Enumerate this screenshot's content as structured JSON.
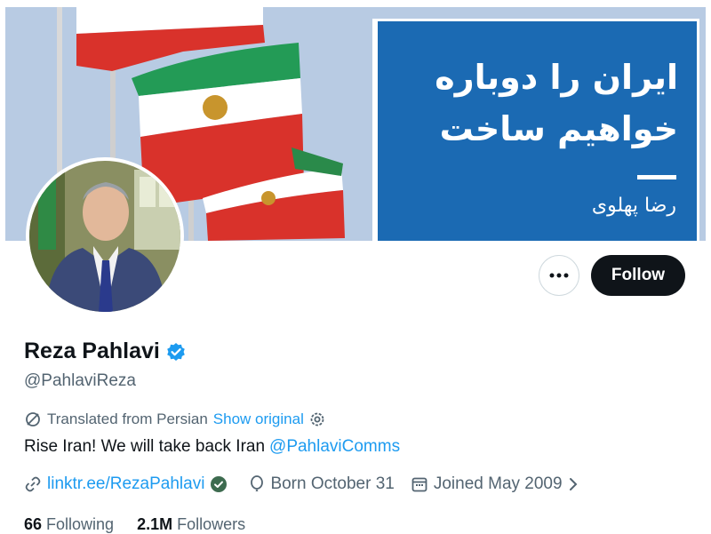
{
  "banner": {
    "line1": "ایران را دوباره",
    "line2": "خواهیم ساخت",
    "signature": "رضا پهلوی",
    "panel_color": "#1b6ab3"
  },
  "profile": {
    "display_name": "Reza Pahlavi",
    "handle": "@PahlaviReza",
    "verified_icon": "verified-badge-icon",
    "verified_color": "#1d9bf0"
  },
  "actions": {
    "more_label": "•••",
    "follow_label": "Follow"
  },
  "translation": {
    "text": "Translated from Persian",
    "show_original": "Show original"
  },
  "bio": {
    "text": "Rise Iran! We will take back Iran",
    "mention": "@PahlaviComms"
  },
  "meta": {
    "link": "linktr.ee/RezaPahlavi",
    "birthday": "Born October 31",
    "joined": "Joined May 2009"
  },
  "counts": {
    "following_count": "66",
    "following_label": "Following",
    "followers_count": "2.1M",
    "followers_label": "Followers"
  }
}
